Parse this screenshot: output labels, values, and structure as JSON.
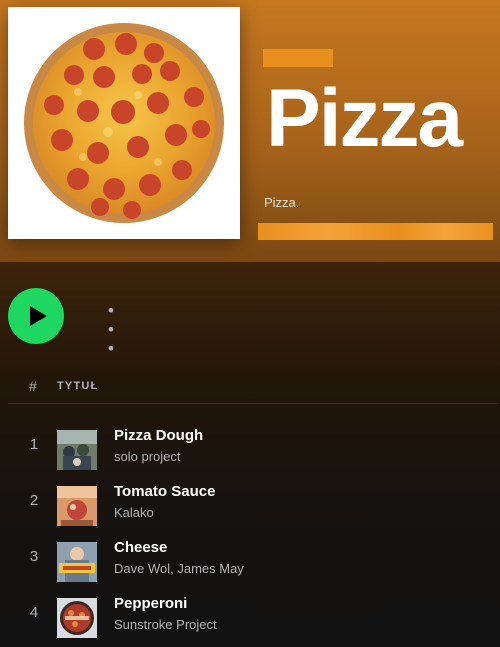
{
  "playlist": {
    "title": "Pizza",
    "description": "Pizza."
  },
  "controls": {
    "play_icon": "play-icon",
    "more_label": "• • •"
  },
  "columns": {
    "number": "#",
    "title": "TYTUŁ"
  },
  "tracks": [
    {
      "number": "1",
      "title": "Pizza Dough",
      "artist": "solo project"
    },
    {
      "number": "2",
      "title": "Tomato Sauce",
      "artist": "Kalako"
    },
    {
      "number": "3",
      "title": "Cheese",
      "artist": "Dave Wol, James May"
    },
    {
      "number": "4",
      "title": "Pepperoni",
      "artist": "Sunstroke Project"
    }
  ],
  "colors": {
    "accent": "#1ed760",
    "header": "#c7781f",
    "background": "#121212"
  }
}
